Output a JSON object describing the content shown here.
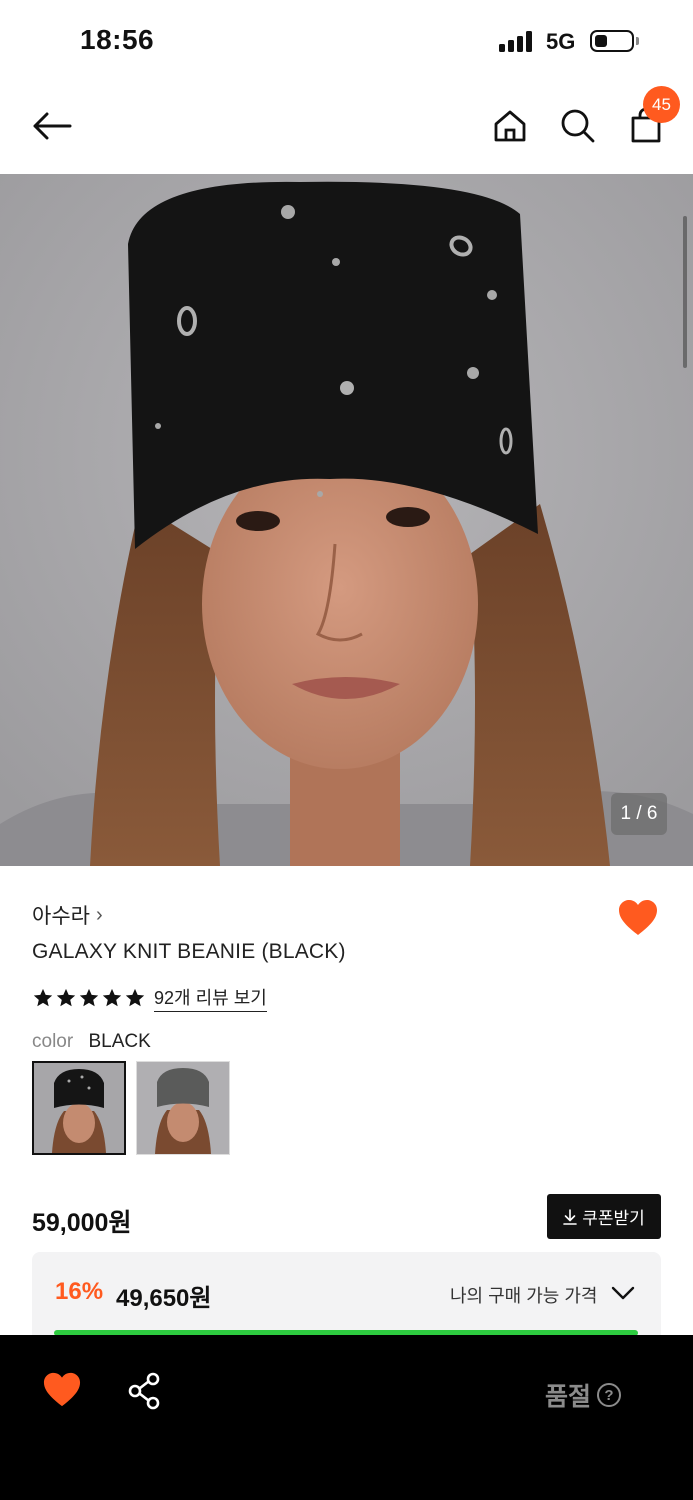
{
  "status_bar": {
    "time": "18:56",
    "network": "5G",
    "battery_level": 0.25
  },
  "nav": {
    "back_icon": "arrow-left-icon",
    "home_icon": "home-icon",
    "search_icon": "search-icon",
    "cart_icon": "shopping-bag-icon",
    "cart_count": "45"
  },
  "gallery": {
    "indicator": "1 / 6",
    "current": 1,
    "total": 6
  },
  "product": {
    "brand": "아수라",
    "brand_chevron": "›",
    "name": "GALAXY KNIT BEANIE (BLACK)",
    "rating": 5,
    "reviews_link": "92개 리뷰 보기",
    "wishlisted": true
  },
  "color": {
    "label": "color",
    "selected": "BLACK",
    "options": [
      "BLACK",
      "GREY"
    ]
  },
  "price": {
    "original": "59,000원",
    "coupon_button": "쿠폰받기",
    "discount_rate": "16%",
    "discount_price": "49,650원",
    "my_price_label": "나의 구매 가능 가격"
  },
  "bottom_bar": {
    "soldout_label": "품절",
    "help_glyph": "?"
  },
  "colors": {
    "accent": "#ff5a1f",
    "progress": "#2ecc40",
    "bottom_bar_bg": "#000000"
  }
}
